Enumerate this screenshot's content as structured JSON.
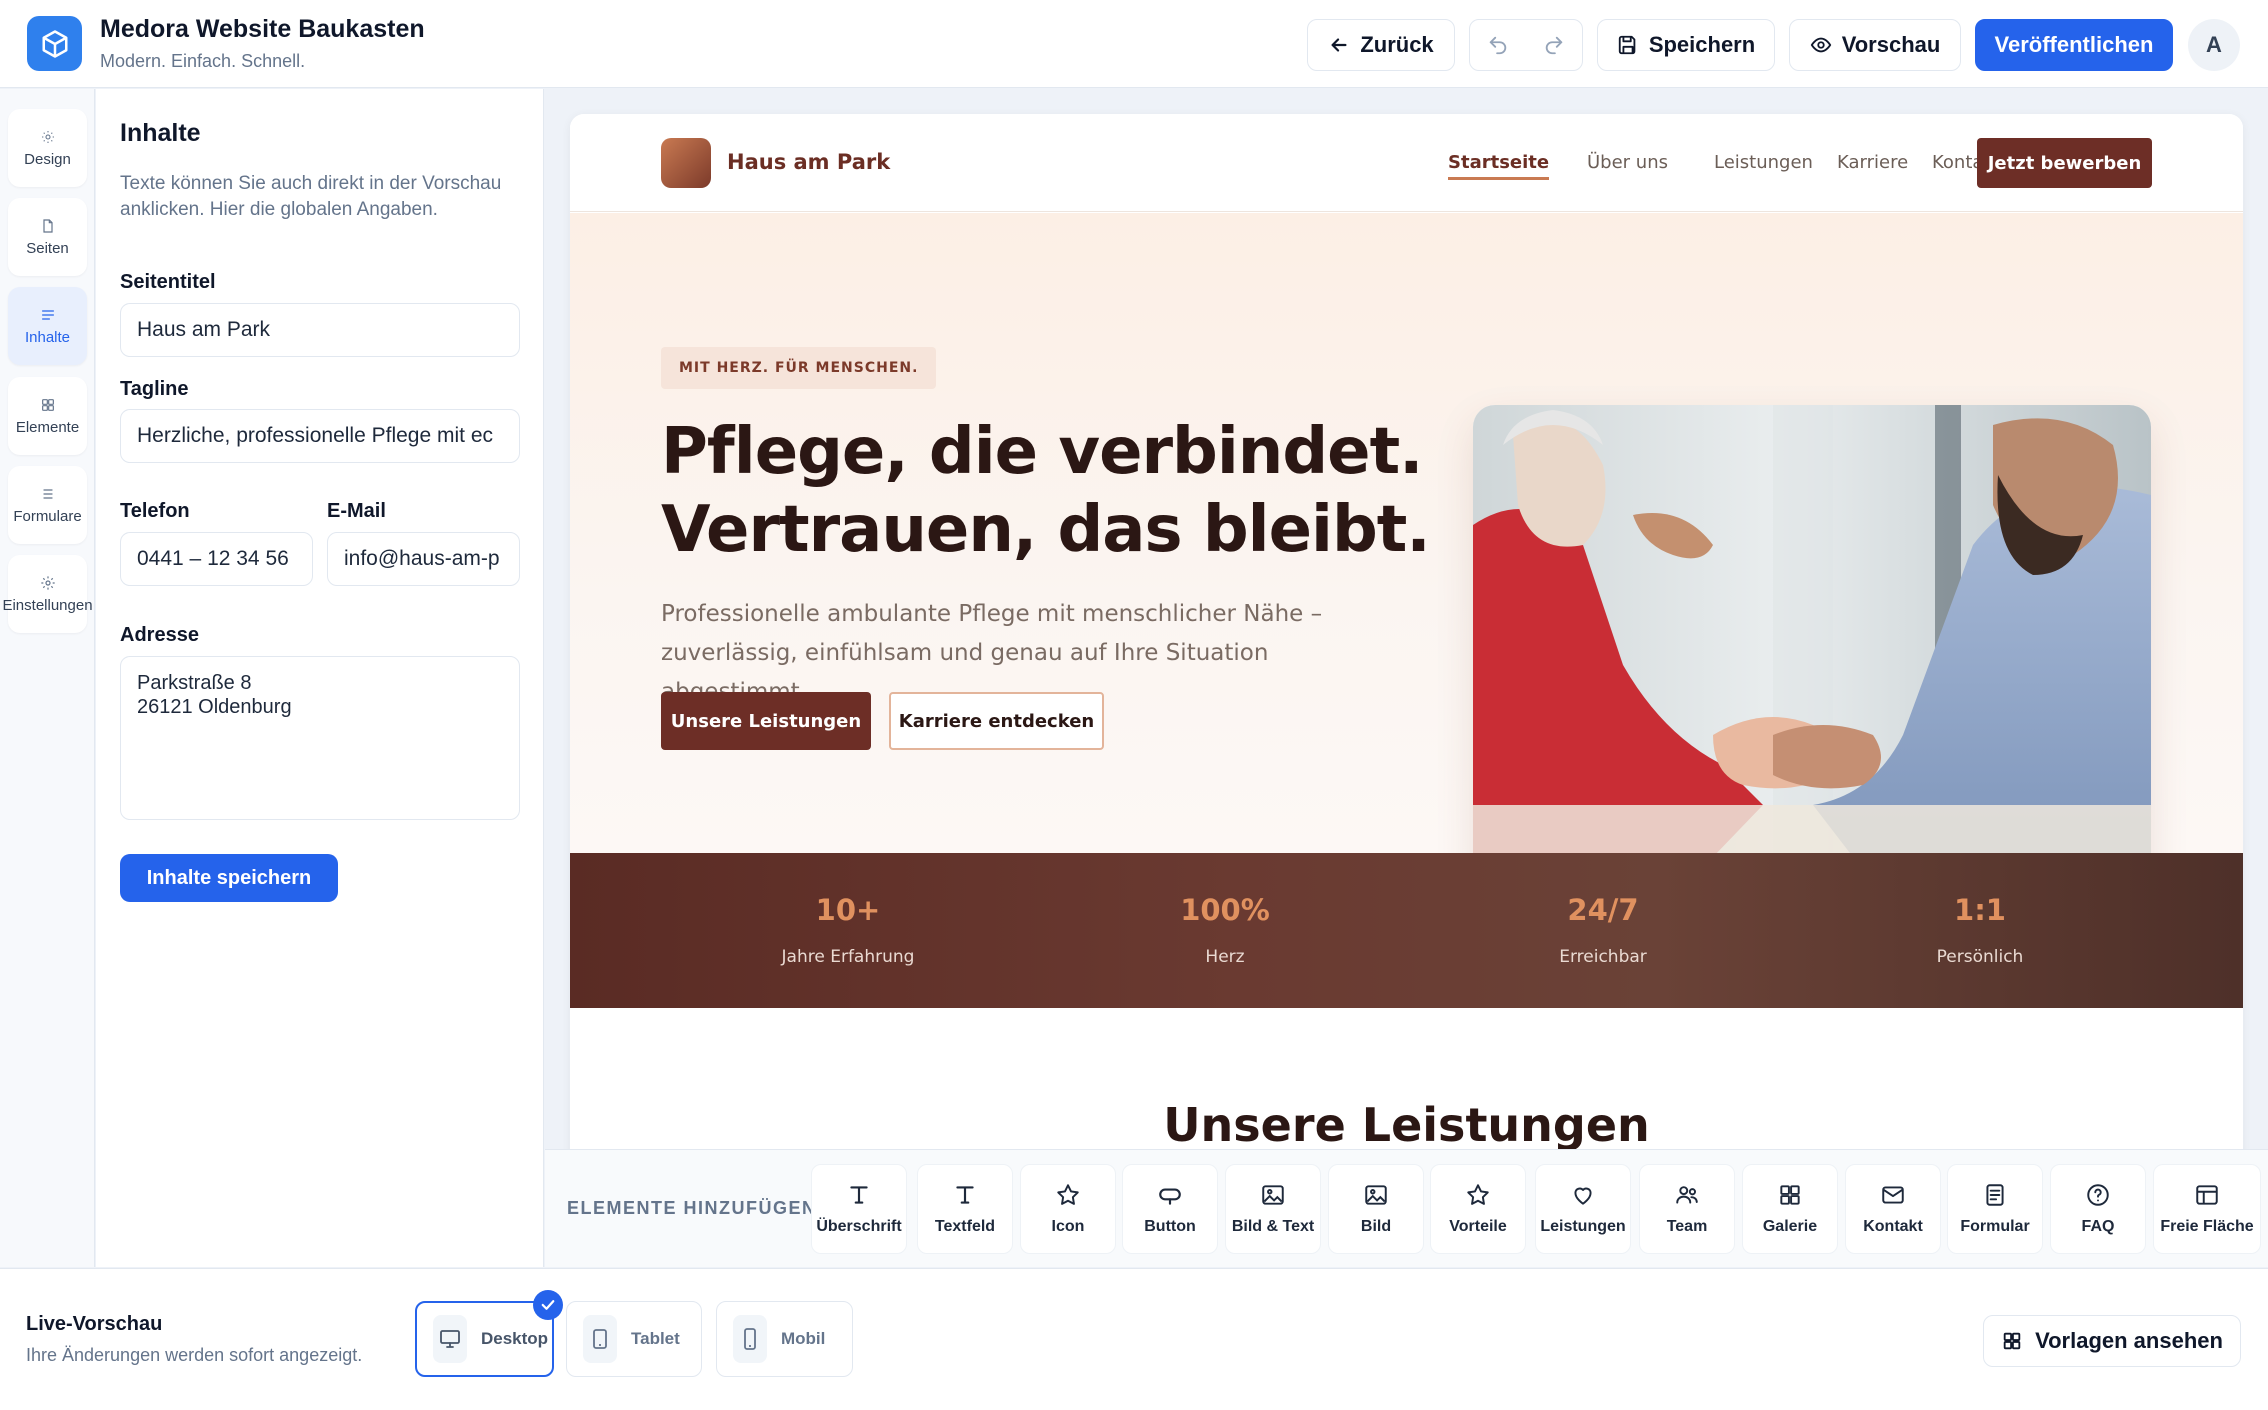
{
  "app": {
    "title": "Medora Website Baukasten",
    "subtitle": "Modern. Einfach. Schnell.",
    "logo_icon": "cube-icon",
    "accent": "#2563eb"
  },
  "toolbar": {
    "back": "Zurück",
    "save": "Speichern",
    "preview": "Vorschau",
    "publish": "Veröffentlichen",
    "avatar": "A"
  },
  "rail": {
    "items": [
      {
        "label": "Design",
        "icon": "sun-icon",
        "active": false
      },
      {
        "label": "Seiten",
        "icon": "file-icon",
        "active": false
      },
      {
        "label": "Inhalte",
        "icon": "lines-icon",
        "active": true
      },
      {
        "label": "Elemente",
        "icon": "grid-icon",
        "active": false
      },
      {
        "label": "Formulare",
        "icon": "list-icon",
        "active": false
      },
      {
        "label": "Einstellungen",
        "icon": "gear-icon",
        "active": false
      }
    ]
  },
  "panel": {
    "title": "Inhalte",
    "description": "Texte können Sie auch direkt in der Vorschau anklicken. Hier die globalen Angaben.",
    "fields": {
      "site_title_label": "Seitentitel",
      "site_title_value": "Haus am Park",
      "tagline_label": "Tagline",
      "tagline_value": "Herzliche, professionelle Pflege mit ec",
      "phone_label": "Telefon",
      "phone_value": "0441 – 12 34 56",
      "email_label": "E-Mail",
      "email_value": "info@haus-am-p",
      "address_label": "Adresse",
      "address_value": "Parkstraße 8\n26121 Oldenburg"
    },
    "save_button": "Inhalte speichern"
  },
  "site": {
    "brand": "Haus am Park",
    "nav": [
      "Startseite",
      "Über uns",
      "Leistungen",
      "Karriere",
      "Kontakt"
    ],
    "nav_active": "Startseite",
    "cta": "Jetzt bewerben",
    "kicker": "MIT HERZ. FÜR MENSCHEN.",
    "headline_1": "Pflege, die verbindet.",
    "headline_2": "Vertrauen, das bleibt.",
    "text": "Professionelle ambulante Pflege mit menschlicher Nähe – zuverlässig, einfühlsam und genau auf Ihre Situation abgestimmt.",
    "button_primary": "Unsere Leistungen",
    "button_secondary": "Karriere entdecken",
    "stats": [
      {
        "value": "10+",
        "label": "Jahre Erfahrung"
      },
      {
        "value": "100%",
        "label": "Herz"
      },
      {
        "value": "24/7",
        "label": "Erreichbar"
      },
      {
        "value": "1:1",
        "label": "Persönlich"
      }
    ],
    "section_title": "Unsere Leistungen",
    "colors": {
      "primary": "#6d2e26",
      "accent": "#c97a52",
      "hero_bg": "#fcefe5"
    }
  },
  "elements": {
    "label": "ELEMENTE HINZUFÜGEN",
    "items": [
      {
        "label": "Überschrift",
        "icon": "heading-icon"
      },
      {
        "label": "Textfeld",
        "icon": "text-icon"
      },
      {
        "label": "Icon",
        "icon": "star-icon"
      },
      {
        "label": "Button",
        "icon": "button-icon"
      },
      {
        "label": "Bild & Text",
        "icon": "image-text-icon"
      },
      {
        "label": "Bild",
        "icon": "image-icon"
      },
      {
        "label": "Vorteile",
        "icon": "star-icon"
      },
      {
        "label": "Leistungen",
        "icon": "heart-icon"
      },
      {
        "label": "Team",
        "icon": "users-icon"
      },
      {
        "label": "Galerie",
        "icon": "grid-icon"
      },
      {
        "label": "Kontakt",
        "icon": "mail-icon"
      },
      {
        "label": "Formular",
        "icon": "form-icon"
      },
      {
        "label": "FAQ",
        "icon": "question-icon"
      },
      {
        "label": "Freie Fläche",
        "icon": "layout-icon"
      }
    ]
  },
  "bottom": {
    "title": "Live-Vorschau",
    "subtitle": "Ihre Änderungen werden sofort angezeigt.",
    "devices": [
      {
        "label": "Desktop",
        "icon": "monitor-icon",
        "active": true
      },
      {
        "label": "Tablet",
        "icon": "tablet-icon",
        "active": false
      },
      {
        "label": "Mobil",
        "icon": "phone-icon",
        "active": false
      }
    ],
    "templates": "Vorlagen ansehen"
  }
}
